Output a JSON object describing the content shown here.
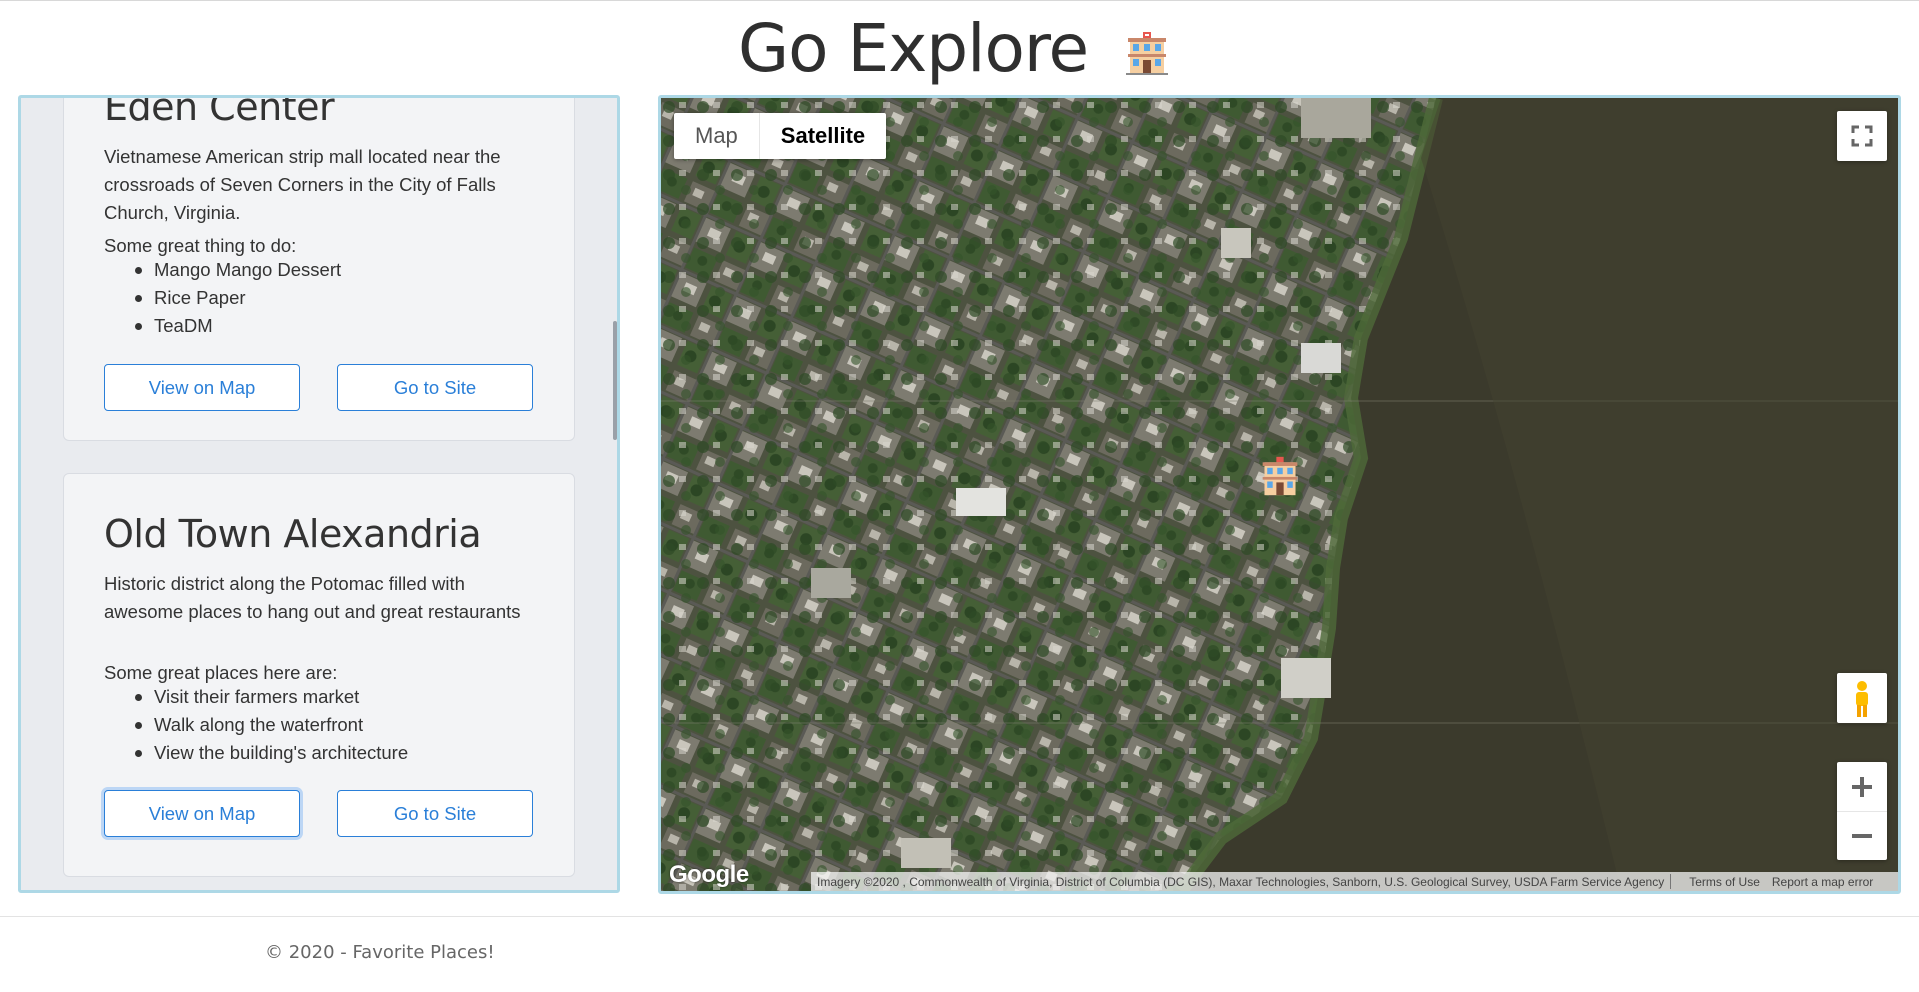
{
  "header": {
    "title": "Go Explore",
    "icon": "building-icon"
  },
  "places": [
    {
      "title": "Eden Center",
      "description": "Vietnamese American strip mall located near the crossroads of Seven Corners in the City of Falls Church, Virginia.",
      "subheading": "Some great thing to do:",
      "items": [
        "Mango Mango Dessert",
        "Rice Paper",
        "TeaDM"
      ],
      "view_button": "View on Map",
      "site_button": "Go to Site"
    },
    {
      "title": "Old Town Alexandria",
      "description": "Historic district along the Potomac filled with awesome places to hang out and great restaurants",
      "subheading": "Some great places here are:",
      "items": [
        "Visit their farmers market",
        "Walk along the waterfront",
        "View the building's architecture"
      ],
      "view_button": "View on Map",
      "site_button": "Go to Site"
    }
  ],
  "map": {
    "type_options": [
      "Map",
      "Satellite"
    ],
    "selected_type": "Satellite",
    "logo": "Google",
    "imagery": "Imagery ©2020 , Commonwealth of Virginia, District of Columbia (DC GIS), Maxar Technologies, Sanborn, U.S. Geological Survey, USDA Farm Service Agency",
    "terms": "Terms of Use",
    "report": "Report a map error",
    "watermark": "© 2020 Google",
    "controls": [
      "fullscreen-icon",
      "pegman-icon",
      "zoom-in-icon",
      "zoom-out-icon"
    ]
  },
  "footer": {
    "text": "© 2020 - Favorite Places!"
  },
  "colors": {
    "panel_border": "#add8e6",
    "button_blue": "#2a7fd8",
    "card_bg": "#f3f4f6",
    "water": "#3b3a2c"
  }
}
